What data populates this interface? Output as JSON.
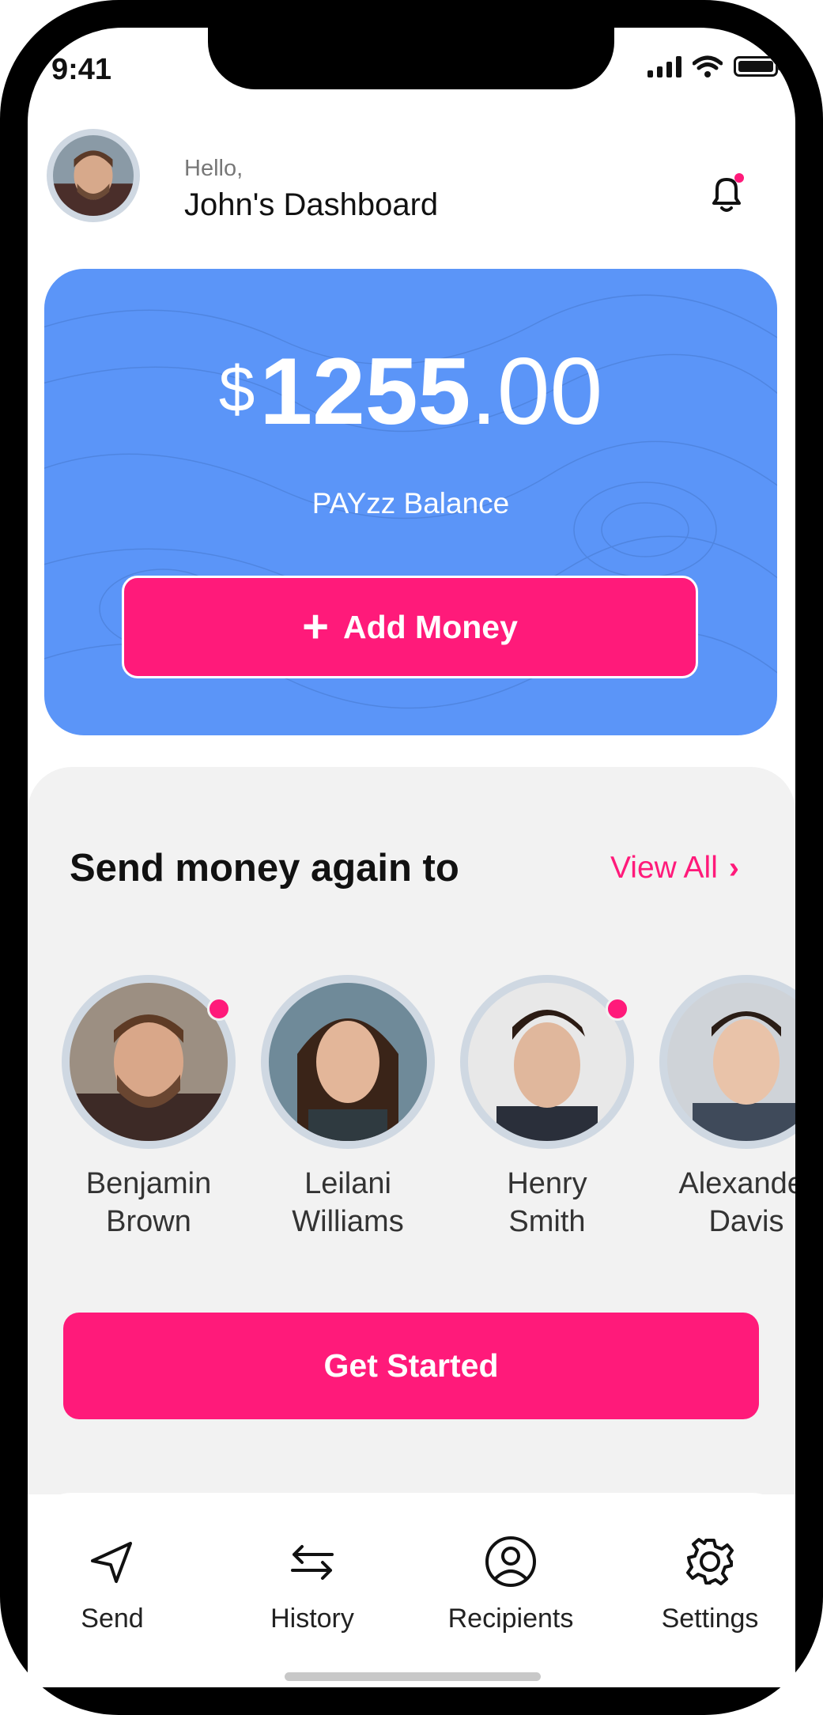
{
  "status_bar": {
    "time": "9:41"
  },
  "header": {
    "greeting": "Hello,",
    "title": "John's Dashboard"
  },
  "balance": {
    "currency": "$",
    "whole": "1255",
    "cents": ".00",
    "label": "PAYzz Balance",
    "add_label": "Add Money"
  },
  "send_again": {
    "title": "Send money again to",
    "view_all": "View All",
    "recipients": [
      {
        "first": "Benjamin",
        "last": "Brown",
        "online": true
      },
      {
        "first": "Leilani",
        "last": "Williams",
        "online": false
      },
      {
        "first": "Henry",
        "last": "Smith",
        "online": true
      },
      {
        "first": "Alexander",
        "last": "Davis",
        "online": false
      }
    ]
  },
  "cta": {
    "label": "Get Started"
  },
  "nav": [
    {
      "label": "Send",
      "icon": "send-icon"
    },
    {
      "label": "History",
      "icon": "history-arrows-icon"
    },
    {
      "label": "Recipients",
      "icon": "user-circle-icon"
    },
    {
      "label": "Settings",
      "icon": "gear-icon"
    }
  ],
  "colors": {
    "accent": "#ff1a7a",
    "card": "#5b95f8",
    "panel": "#f2f2f2"
  }
}
